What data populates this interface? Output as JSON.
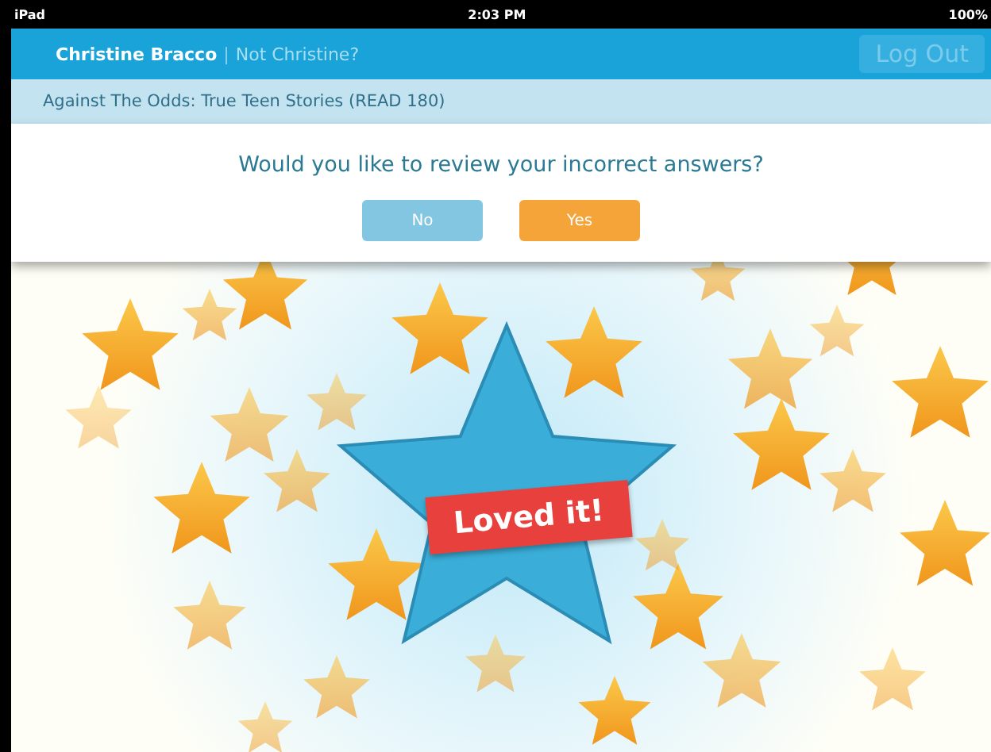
{
  "status_bar": {
    "device": "iPad",
    "time": "2:03 PM",
    "battery": "100%"
  },
  "header": {
    "user": "Christine Bracco",
    "separator": "|",
    "switch_link": "Not Christine?",
    "logout": "Log Out"
  },
  "breadcrumb": "Against The Odds: True Teen Stories (READ 180)",
  "dialog": {
    "question": "Would you like to review your incorrect answers?",
    "buttons": [
      {
        "label": "No",
        "kind": "secondary"
      },
      {
        "label": "Yes",
        "kind": "primary"
      }
    ]
  },
  "reward": {
    "ribbon": "Loved it!"
  }
}
